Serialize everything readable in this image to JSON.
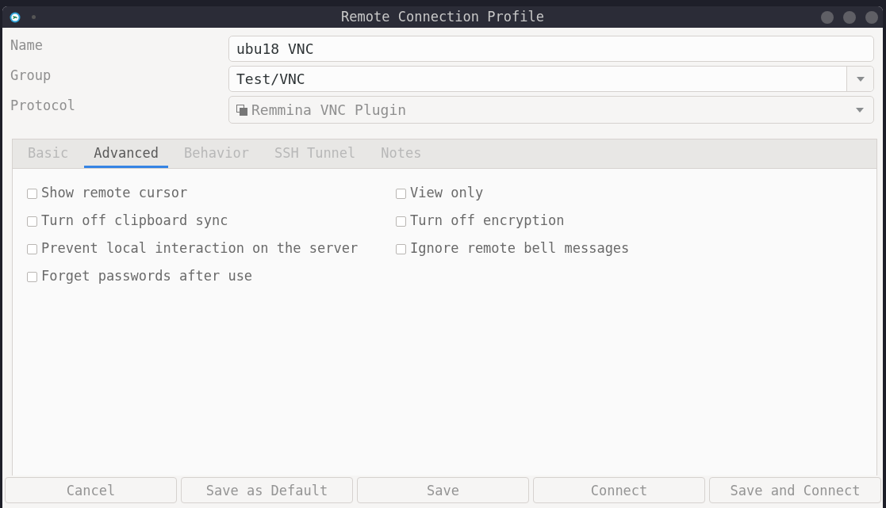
{
  "window": {
    "title": "Remote Connection Profile"
  },
  "fields": [
    {
      "kind": "entry",
      "label": "Name",
      "value": "ubu18 VNC"
    },
    {
      "kind": "combo-entry",
      "label": "Group",
      "value": "Test/VNC"
    },
    {
      "kind": "combo",
      "label": "Protocol",
      "value": "Remmina VNC Plugin"
    }
  ],
  "tabs": [
    {
      "label": "Basic",
      "selected": false
    },
    {
      "label": "Advanced",
      "selected": true
    },
    {
      "label": "Behavior",
      "selected": false
    },
    {
      "label": "SSH Tunnel",
      "selected": false
    },
    {
      "label": "Notes",
      "selected": false
    }
  ],
  "options": [
    {
      "label": "Show remote cursor",
      "checked": false
    },
    {
      "label": "View only",
      "checked": false
    },
    {
      "label": "Turn off clipboard sync",
      "checked": false
    },
    {
      "label": "Turn off encryption",
      "checked": false
    },
    {
      "label": "Prevent local interaction on the server",
      "checked": false
    },
    {
      "label": "Ignore remote bell messages",
      "checked": false
    },
    {
      "label": "Forget passwords after use",
      "checked": false
    }
  ],
  "buttons": [
    "Cancel",
    "Save as Default",
    "Save",
    "Connect",
    "Save and Connect"
  ]
}
